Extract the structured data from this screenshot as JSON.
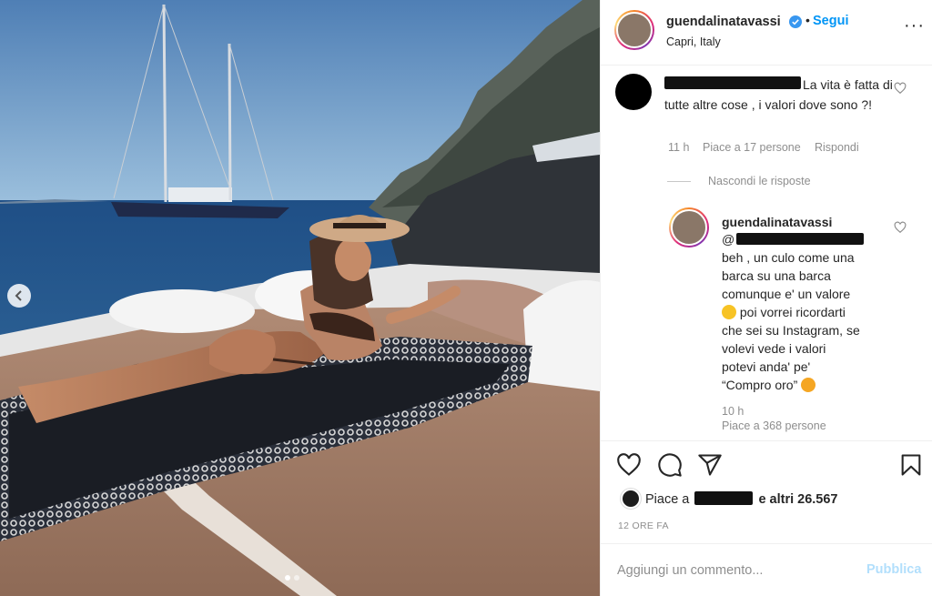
{
  "post": {
    "username": "guendalinatavassi",
    "follow_label": "Segui",
    "separator": "•",
    "location": "Capri, Italy"
  },
  "comments": [
    {
      "text": "La vita è fatta di tutte altre cose , i valori dove sono ?!",
      "time": "11 h",
      "likes": "Piace a 17 persone",
      "reply_label": "Rispondi",
      "hide_replies_label": "Nascondi le risposte"
    }
  ],
  "reply": {
    "username": "guendalinatavassi",
    "mention_prefix": "@",
    "lines": [
      "beh , un culo come una",
      "barca su una barca",
      "comunque e' un valore",
      " poi vorrei ricordarti",
      "che sei su Instagram, se",
      "volevi vede i valori",
      "potevi anda' pe'",
      "“Compro oro” "
    ],
    "time": "10 h",
    "likes": "Piace a 368 persone"
  },
  "likes_summary": {
    "prefix": "Piace a",
    "suffix": "e altri 26.567"
  },
  "timestamp": "12 ORE FA",
  "add_comment": {
    "placeholder": "Aggiungi un commento...",
    "publish_label": "Pubblica"
  },
  "icons": {
    "verified": "verified-badge-icon",
    "more": "more-options-icon",
    "like": "heart-icon",
    "comment": "comment-icon",
    "share": "paper-plane-icon",
    "save": "bookmark-icon",
    "carousel_prev": "chevron-left-icon"
  },
  "colors": {
    "accent": "#0095f6",
    "publish_disabled": "#b2dffc",
    "muted": "#8e8e8e",
    "text": "#262626"
  },
  "carousel": {
    "slide_count": 2,
    "active_slide": 1
  }
}
